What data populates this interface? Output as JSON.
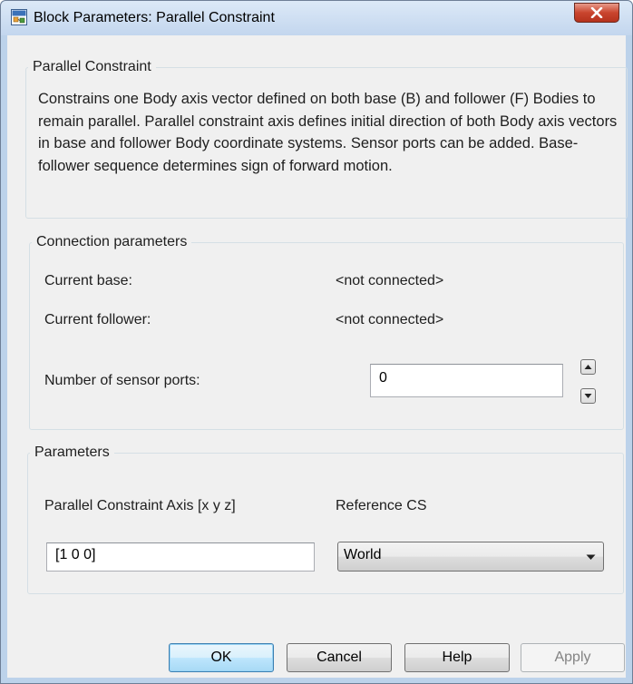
{
  "window": {
    "title": "Block Parameters: Parallel Constraint",
    "icon": "simulink-block-icon",
    "close_icon": "close-icon"
  },
  "description_group": {
    "legend": "Parallel Constraint",
    "text": "Constrains one Body axis vector defined on both base (B) and follower (F) Bodies to remain parallel. Parallel constraint axis defines initial direction of both Body axis vectors in base and follower Body coordinate systems. Sensor ports can be added. Base-follower sequence determines sign of forward motion."
  },
  "connection_group": {
    "legend": "Connection parameters",
    "current_base_label": "Current base:",
    "current_base_value": "<not connected>",
    "current_follower_label": "Current follower:",
    "current_follower_value": "<not connected>",
    "sensor_ports_label": "Number of sensor ports:",
    "sensor_ports_value": "0"
  },
  "parameters_group": {
    "legend": "Parameters",
    "axis_label": "Parallel Constraint Axis [x y z]",
    "axis_value": "[1 0 0]",
    "reference_cs_label": "Reference CS",
    "reference_cs_selected": "World"
  },
  "buttons": {
    "ok": "OK",
    "cancel": "Cancel",
    "help": "Help",
    "apply": "Apply"
  },
  "colors": {
    "title_bar": "#c3d6ee",
    "close_button": "#c9452e",
    "dialog_bg": "#f0f0f0",
    "default_button": "#bee6fd"
  }
}
